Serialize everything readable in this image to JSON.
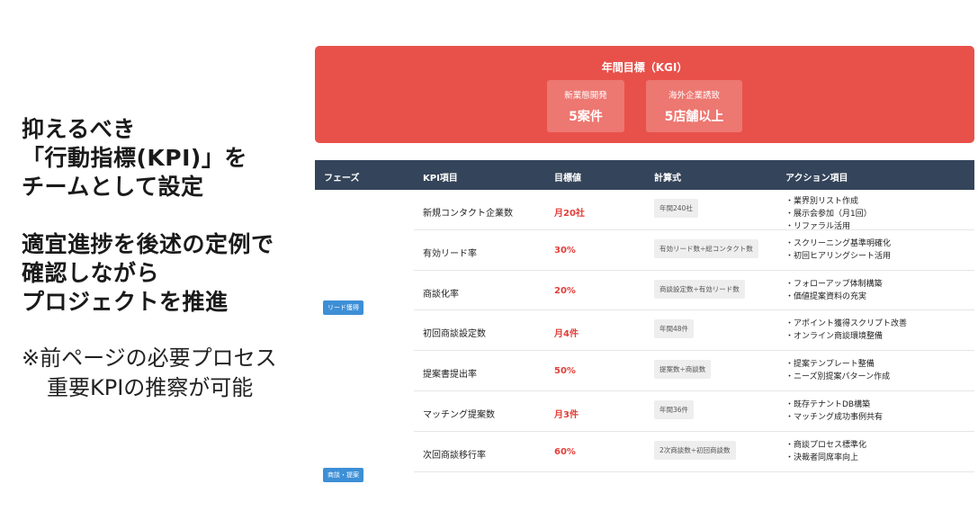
{
  "left": {
    "lead_lines": [
      "抑えるべき",
      "「行動指標(KPI)」を",
      "チームとして設定"
    ],
    "lead_lines2": [
      "適宜進捗を後述の定例で",
      "確認しながら",
      "プロジェクトを推進"
    ],
    "note_lines": [
      "※前ページの必要プロセス",
      "重要KPIの推察が可能"
    ]
  },
  "kgi": {
    "title": "年間目標（KGI）",
    "boxes": [
      {
        "label": "新業態開発",
        "value": "5案件"
      },
      {
        "label": "海外企業誘致",
        "value": "5店舗以上"
      }
    ]
  },
  "table": {
    "headers": [
      "フェーズ",
      "KPI項目",
      "目標値",
      "計算式",
      "アクション項目"
    ],
    "phases": [
      "リード獲得",
      "商談・提案"
    ],
    "rows": [
      {
        "item": "新規コンタクト企業数",
        "target": "月20社",
        "formula": "年間240社",
        "actions": [
          "・業界別リスト作成",
          "・展示会参加（月1回）",
          "・リファラル活用"
        ]
      },
      {
        "item": "有効リード率",
        "target": "30%",
        "formula": "有効リード数÷総コンタクト数",
        "actions": [
          "・スクリーニング基準明確化",
          "・初回ヒアリングシート活用"
        ]
      },
      {
        "item": "商談化率",
        "target": "20%",
        "formula": "商談設定数÷有効リード数",
        "actions": [
          "・フォローアップ体制構築",
          "・価値提案資料の充実"
        ]
      },
      {
        "item": "初回商談設定数",
        "target": "月4件",
        "formula": "年間48件",
        "actions": [
          "・アポイント獲得スクリプト改善",
          "・オンライン商談環境整備"
        ]
      },
      {
        "item": "提案書提出率",
        "target": "50%",
        "formula": "提案数÷商談数",
        "actions": [
          "・提案テンプレート整備",
          "・ニーズ別提案パターン作成"
        ]
      },
      {
        "item": "マッチング提案数",
        "target": "月3件",
        "formula": "年間36件",
        "actions": [
          "・既存テナントDB構築",
          "・マッチング成功事例共有"
        ]
      },
      {
        "item": "次回商談移行率",
        "target": "60%",
        "formula": "2次商談数÷初回商談数",
        "actions": [
          "・商談プロセス標準化",
          "・決裁者同席率向上"
        ]
      }
    ]
  },
  "colors": {
    "accent_red": "#e8514a",
    "header_navy": "#34445a",
    "phase_blue": "#3d8fd6",
    "target_red": "#e0403a"
  }
}
